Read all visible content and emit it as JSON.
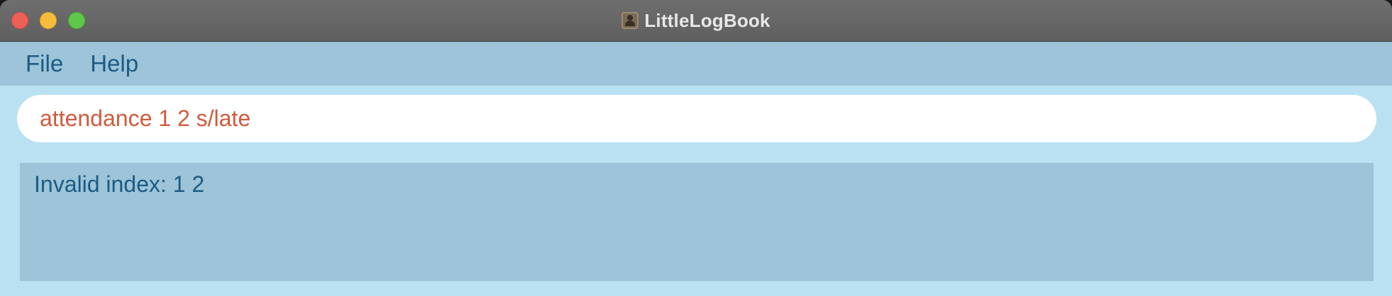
{
  "window": {
    "title": "LittleLogBook",
    "controls": {
      "close": "close-button",
      "minimize": "minimize-button",
      "zoom": "zoom-button"
    }
  },
  "menubar": {
    "items": [
      {
        "label": "File"
      },
      {
        "label": "Help"
      }
    ]
  },
  "command": {
    "value": "attendance 1 2 s/late"
  },
  "result": {
    "message": "Invalid index: 1 2"
  },
  "colors": {
    "titlebar": "#656565",
    "menubar": "#9dc4d8",
    "background": "#b9e1f2",
    "menu_text": "#1c5b85",
    "command_text": "#d05a3c",
    "result_text": "#1c5b85"
  }
}
